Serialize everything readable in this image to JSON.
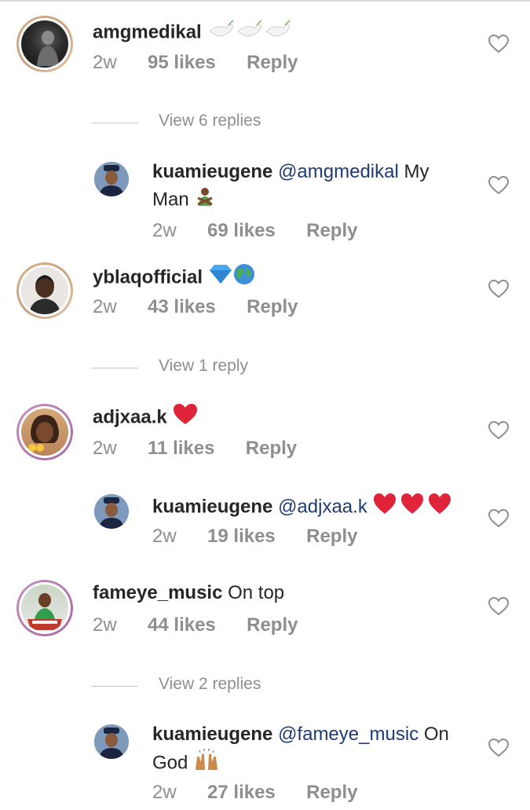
{
  "comments": [
    {
      "username": "amgmedikal",
      "text": "",
      "emoji": "dove x3",
      "time": "2w",
      "likes": "95 likes",
      "reply": "Reply"
    },
    {
      "username": "kuamieugene",
      "mention": "@amgmedikal",
      "text_a": "My",
      "text_b": "Man",
      "emoji": "man gesturing no",
      "time": "2w",
      "likes": "69 likes",
      "reply": "Reply"
    },
    {
      "username": "yblaqofficial",
      "text": "",
      "emoji": "gem, globe",
      "time": "2w",
      "likes": "43 likes",
      "reply": "Reply"
    },
    {
      "username": "adjxaa.k",
      "text": "",
      "emoji": "red heart",
      "time": "2w",
      "likes": "11 likes",
      "reply": "Reply"
    },
    {
      "username": "kuamieugene",
      "mention": "@adjxaa.k",
      "emoji": "red heart x3",
      "time": "2w",
      "likes": "19 likes",
      "reply": "Reply"
    },
    {
      "username": "fameye_music",
      "text": "On top",
      "time": "2w",
      "likes": "44 likes",
      "reply": "Reply"
    },
    {
      "username": "kuamieugene",
      "mention": "@fameye_music",
      "text_a": "On",
      "text_b": "God",
      "emoji": "raising hands",
      "time": "2w",
      "likes": "27 likes",
      "reply": "Reply"
    }
  ],
  "view_replies": [
    "View 6 replies",
    "View 1 reply",
    "View 2 replies"
  ],
  "icons": {
    "like": "heart-outline-icon"
  },
  "colors": {
    "text": "#262626",
    "meta": "#8e8e8e",
    "mention": "#1e3a75",
    "heart_red": "#e0243a"
  }
}
